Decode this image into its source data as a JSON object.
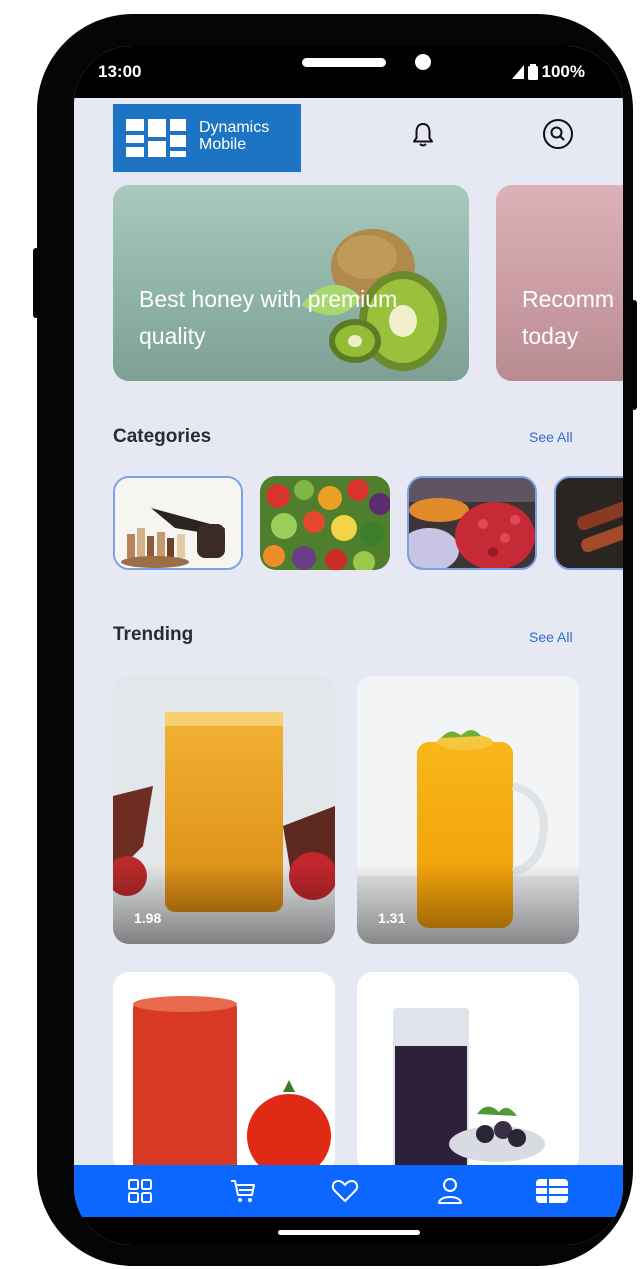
{
  "status_bar": {
    "time": "13:00",
    "battery": "100%"
  },
  "header": {
    "logo": {
      "line1": "Dynamics",
      "line2": "Mobile"
    },
    "icons": [
      "bell-icon",
      "search-icon"
    ]
  },
  "banners": [
    {
      "text": "Best honey with premium quality",
      "color": "#9fc1b5"
    },
    {
      "text": "Recomm today",
      "color": "#d6a7ae"
    }
  ],
  "categories": {
    "title": "Categories",
    "see_all": "See All",
    "items": [
      {
        "name": "tobacco-pipe"
      },
      {
        "name": "vegetables"
      },
      {
        "name": "market-produce"
      },
      {
        "name": "grilled-meat"
      }
    ]
  },
  "trending": {
    "title": "Trending",
    "see_all": "See All",
    "items": [
      {
        "price": "1.98"
      },
      {
        "price": "1.31"
      },
      {
        "price": ""
      },
      {
        "price": ""
      }
    ]
  },
  "bottom_nav": [
    "grid-icon",
    "cart-icon",
    "heart-icon",
    "user-icon",
    "menu-grid-icon"
  ],
  "colors": {
    "accent": "#0b67ff",
    "logo": "#1e74c4",
    "background": "#e6e8f4",
    "link": "#2f6bd6"
  }
}
